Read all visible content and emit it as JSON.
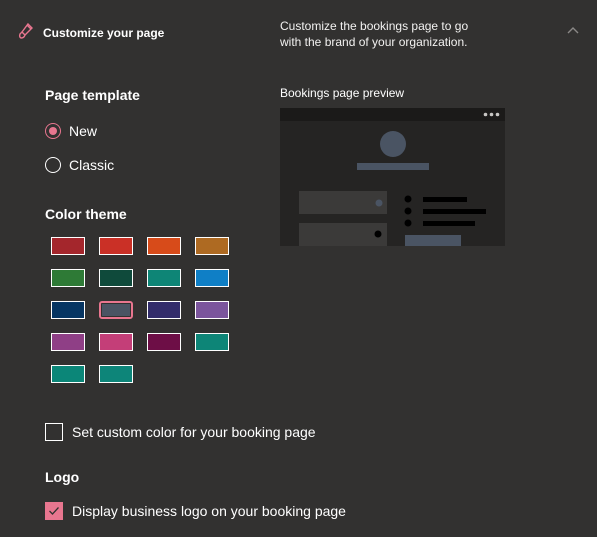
{
  "header": {
    "title": "Customize your page",
    "description_line1": "Customize the bookings page to go",
    "description_line2": "with the brand of your organization."
  },
  "page_template": {
    "label": "Page template",
    "options": [
      "New",
      "Classic"
    ],
    "selected": "New"
  },
  "color_theme": {
    "label": "Color theme",
    "swatches": [
      "#a4262c",
      "#ca3026",
      "#d74b1a",
      "#ae6a22",
      "#2e7a36",
      "#0f4a3b",
      "#0e8576",
      "#0f7fc6",
      "#063562",
      "#4a5463",
      "#322c6a",
      "#7b559c",
      "#8f3f86",
      "#c43e78",
      "#6d0e46",
      "#0d8577",
      "#0b8678",
      "#0d8579"
    ],
    "selected_index": 9
  },
  "custom_color": {
    "label": "Set custom color for your booking page",
    "checked": false
  },
  "logo": {
    "label": "Logo",
    "display_label": "Display business logo on your booking page",
    "checked": true
  },
  "preview": {
    "label": "Bookings page preview",
    "menu_icon": "more-dots-icon"
  },
  "colors": {
    "accent": "#e8768f",
    "background": "#323130"
  }
}
